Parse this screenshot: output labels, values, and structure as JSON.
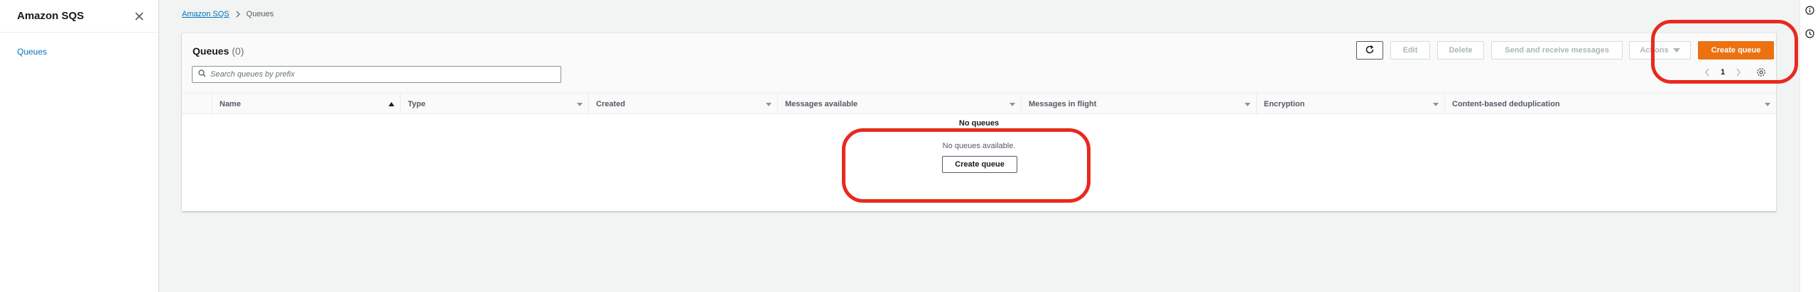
{
  "sidebar": {
    "title": "Amazon SQS",
    "items": [
      {
        "label": "Queues"
      }
    ]
  },
  "breadcrumb": {
    "root": "Amazon SQS",
    "current": "Queues"
  },
  "panel": {
    "title": "Queues",
    "count": "(0)",
    "search_placeholder": "Search queues by prefix",
    "buttons": {
      "edit": "Edit",
      "delete": "Delete",
      "send_receive": "Send and receive messages",
      "actions": "Actions",
      "create": "Create queue"
    },
    "pagination": {
      "page": "1"
    }
  },
  "table": {
    "columns": [
      "Name",
      "Type",
      "Created",
      "Messages available",
      "Messages in flight",
      "Encryption",
      "Content-based deduplication"
    ],
    "sorted_column": "Name",
    "empty_title": "No queues",
    "empty_desc": "No queues available.",
    "empty_button": "Create queue"
  },
  "colors": {
    "accent": "#ec7211",
    "link": "#0073bb",
    "highlight": "#e8291f"
  },
  "icons": [
    "close-icon",
    "chevron-right-icon",
    "refresh-icon",
    "search-icon",
    "caret-down-icon",
    "chevron-left-icon",
    "settings-icon",
    "info-icon",
    "history-icon"
  ]
}
